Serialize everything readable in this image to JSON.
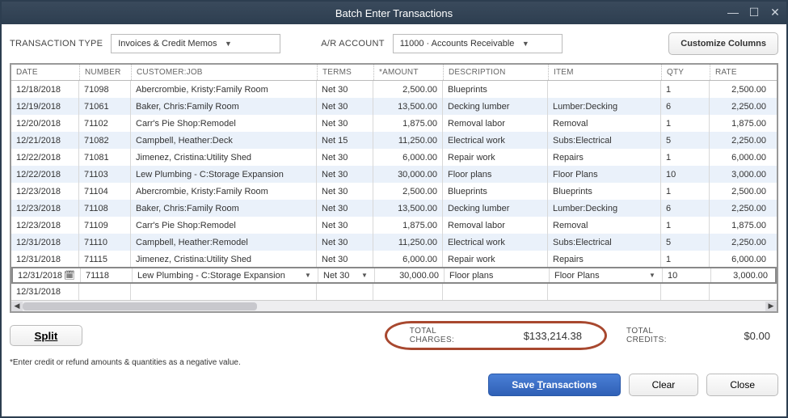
{
  "title": "Batch Enter Transactions",
  "transaction_type_label": "TRANSACTION TYPE",
  "transaction_type_value": "Invoices & Credit Memos",
  "ar_account_label": "A/R ACCOUNT",
  "ar_account_value": "11000 · Accounts Receivable",
  "customize_label": "Customize Columns",
  "headers": {
    "date": "DATE",
    "number": "NUMBER",
    "customer": "CUSTOMER:JOB",
    "terms": "TERMS",
    "amount": "*AMOUNT",
    "description": "DESCRIPTION",
    "item": "ITEM",
    "qty": "QTY",
    "rate": "RATE"
  },
  "rows": [
    {
      "date": "12/18/2018",
      "number": "71098",
      "customer": "Abercrombie, Kristy:Family Room",
      "terms": "Net 30",
      "amount": "2,500.00",
      "description": "Blueprints",
      "item": "",
      "qty": "1",
      "rate": "2,500.00"
    },
    {
      "date": "12/19/2018",
      "number": "71061",
      "customer": "Baker, Chris:Family Room",
      "terms": "Net 30",
      "amount": "13,500.00",
      "description": "Decking lumber",
      "item": "Lumber:Decking",
      "qty": "6",
      "rate": "2,250.00"
    },
    {
      "date": "12/20/2018",
      "number": "71102",
      "customer": "Carr's Pie Shop:Remodel",
      "terms": "Net 30",
      "amount": "1,875.00",
      "description": "Removal labor",
      "item": "Removal",
      "qty": "1",
      "rate": "1,875.00"
    },
    {
      "date": "12/21/2018",
      "number": "71082",
      "customer": "Campbell, Heather:Deck",
      "terms": "Net 15",
      "amount": "11,250.00",
      "description": "Electrical work",
      "item": "Subs:Electrical",
      "qty": "5",
      "rate": "2,250.00"
    },
    {
      "date": "12/22/2018",
      "number": "71081",
      "customer": "Jimenez, Cristina:Utility Shed",
      "terms": "Net 30",
      "amount": "6,000.00",
      "description": "Repair work",
      "item": "Repairs",
      "qty": "1",
      "rate": "6,000.00"
    },
    {
      "date": "12/22/2018",
      "number": "71103",
      "customer": "Lew Plumbing - C:Storage Expansion",
      "terms": "Net 30",
      "amount": "30,000.00",
      "description": "Floor plans",
      "item": "Floor Plans",
      "qty": "10",
      "rate": "3,000.00"
    },
    {
      "date": "12/23/2018",
      "number": "71104",
      "customer": "Abercrombie, Kristy:Family Room",
      "terms": "Net 30",
      "amount": "2,500.00",
      "description": "Blueprints",
      "item": "Blueprints",
      "qty": "1",
      "rate": "2,500.00"
    },
    {
      "date": "12/23/2018",
      "number": "71108",
      "customer": "Baker, Chris:Family Room",
      "terms": "Net 30",
      "amount": "13,500.00",
      "description": "Decking lumber",
      "item": "Lumber:Decking",
      "qty": "6",
      "rate": "2,250.00"
    },
    {
      "date": "12/23/2018",
      "number": "71109",
      "customer": "Carr's Pie Shop:Remodel",
      "terms": "Net 30",
      "amount": "1,875.00",
      "description": "Removal labor",
      "item": "Removal",
      "qty": "1",
      "rate": "1,875.00"
    },
    {
      "date": "12/31/2018",
      "number": "71110",
      "customer": "Campbell, Heather:Remodel",
      "terms": "Net 30",
      "amount": "11,250.00",
      "description": "Electrical work",
      "item": "Subs:Electrical",
      "qty": "5",
      "rate": "2,250.00"
    },
    {
      "date": "12/31/2018",
      "number": "71115",
      "customer": "Jimenez, Cristina:Utility Shed",
      "terms": "Net 30",
      "amount": "6,000.00",
      "description": "Repair work",
      "item": "Repairs",
      "qty": "1",
      "rate": "6,000.00"
    },
    {
      "date": "12/31/2018",
      "number": "71118",
      "customer": "Lew Plumbing - C:Storage Expansion",
      "terms": "Net 30",
      "amount": "30,000.00",
      "description": "Floor plans",
      "item": "Floor Plans",
      "qty": "10",
      "rate": "3,000.00",
      "editing": true
    },
    {
      "date": "12/31/2018",
      "number": "",
      "customer": "",
      "terms": "",
      "amount": "",
      "description": "",
      "item": "",
      "qty": "",
      "rate": ""
    }
  ],
  "split_label": "Split",
  "total_charges_label": "TOTAL CHARGES:",
  "total_charges_value": "$133,214.38",
  "total_credits_label": "TOTAL CREDITS:",
  "total_credits_value": "$0.00",
  "footnote": "*Enter credit or refund amounts & quantities as a negative value.",
  "save_label_pre": "Save ",
  "save_label_ul": "T",
  "save_label_post": "ransactions",
  "clear_label": "Clear",
  "close_label": "Close"
}
